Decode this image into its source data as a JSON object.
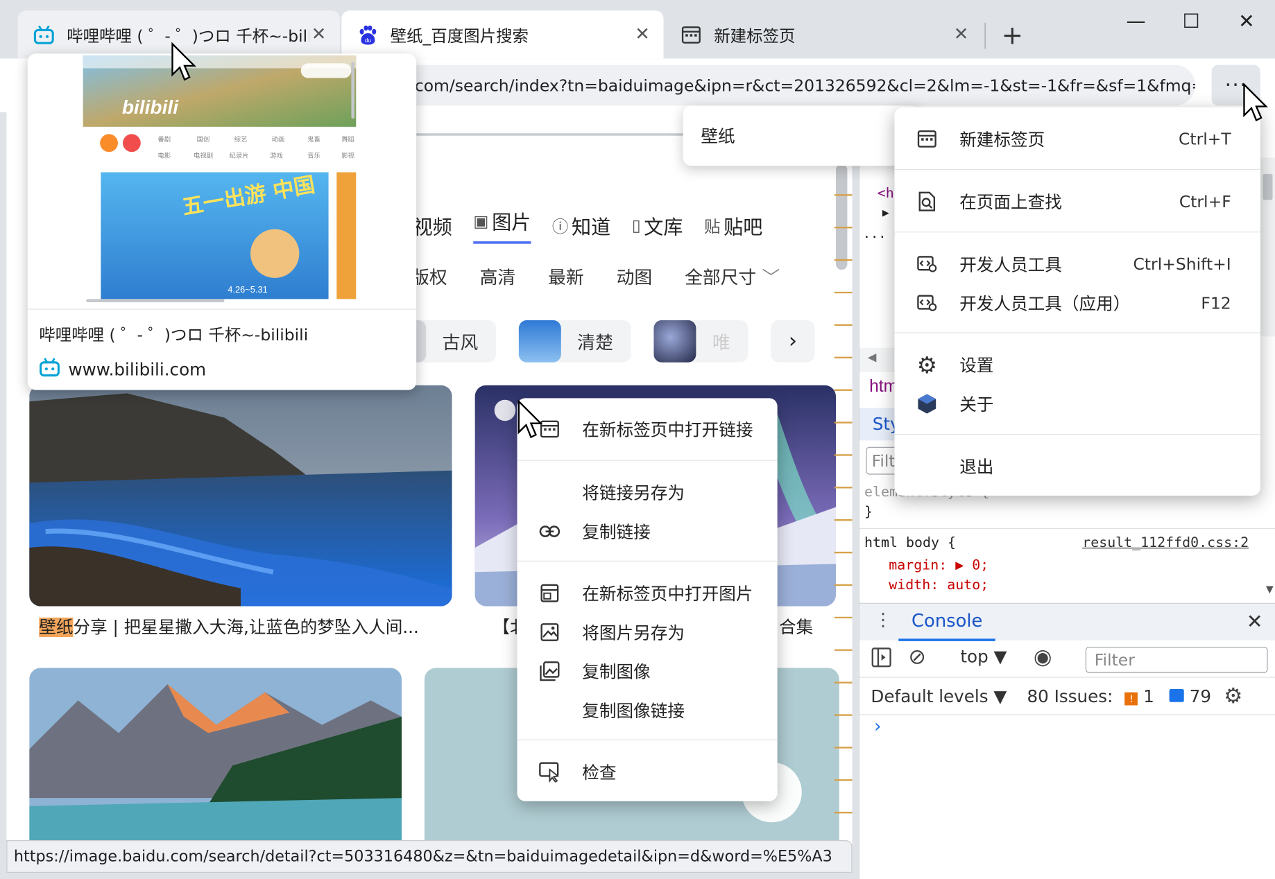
{
  "tabs": [
    {
      "label": "哔哩哔哩 ( ゜- ゜)つロ 千杯~-bilibili",
      "close": "✕"
    },
    {
      "label": "壁纸_百度图片搜索",
      "close": "✕"
    },
    {
      "label": "新建标签页",
      "close": "✕"
    }
  ],
  "new_tab": "+",
  "window_controls": {
    "minimize": "—",
    "maximize": "☐",
    "close": "✕"
  },
  "address_bar": {
    "url": "com/search/index?tn=baiduimage&ipn=r&ct=201326592&cl=2&lm=-1&st=-1&fr=&sf=1&fmq=1"
  },
  "more_button": "···",
  "hover_card": {
    "title": "哔哩哔哩 ( ゜- ゜)つロ 千杯~-bilibili",
    "url": "www.bilibili.com",
    "preview": {
      "brand": "bilibili",
      "banner_text": "五一出游 中国",
      "date_text": "4.26~5.31"
    }
  },
  "search_suggestion": {
    "text": "壁纸"
  },
  "page": {
    "nav_tabs": [
      {
        "label": "视频",
        "icon": "video-icon"
      },
      {
        "label": "图片",
        "icon": "image-icon",
        "active": true
      },
      {
        "label": "知道",
        "icon": "question-icon"
      },
      {
        "label": "文库",
        "icon": "doc-icon"
      },
      {
        "label": "贴吧",
        "icon": "tieba-icon"
      }
    ],
    "filters": [
      "版权",
      "高清",
      "最新",
      "动图",
      "全部尺寸"
    ],
    "tags": [
      {
        "label": "古风",
        "color": "#c9cdd3"
      },
      {
        "label": "清楚",
        "color": "#4a8fe0"
      },
      {
        "label": "唯",
        "color": "#3b3f6a"
      }
    ],
    "tags_next": "›",
    "captions": [
      {
        "highlight": "壁纸",
        "rest": "分享 | 把星星撒入大海,让蓝色的梦坠入人间..."
      },
      {
        "text": "【北",
        "suffix": "合集"
      }
    ]
  },
  "status_bar": {
    "url": "https://image.baidu.com/search/detail?ct=503316480&z=&tn=baiduimagedetail&ipn=d&word=%E5%A3"
  },
  "context_menu": {
    "items": [
      {
        "label": "在新标签页中打开链接",
        "icon": "new-tab-icon"
      },
      {
        "label": "将链接另存为",
        "icon": ""
      },
      {
        "label": "复制链接",
        "icon": "link-icon"
      },
      {
        "label": "在新标签页中打开图片",
        "icon": "open-image-icon"
      },
      {
        "label": "将图片另存为",
        "icon": "save-image-icon"
      },
      {
        "label": "复制图像",
        "icon": "copy-image-icon"
      },
      {
        "label": "复制图像链接",
        "icon": ""
      },
      {
        "label": "检查",
        "icon": "inspect-icon"
      }
    ]
  },
  "app_menu": {
    "items": [
      {
        "label": "新建标签页",
        "shortcut": "Ctrl+T",
        "icon": "new-tab-icon"
      },
      {
        "label": "在页面上查找",
        "shortcut": "Ctrl+F",
        "icon": "find-icon"
      },
      {
        "label": "开发人员工具",
        "shortcut": "Ctrl+Shift+I",
        "icon": "devtools-icon"
      },
      {
        "label": "开发人员工具（应用）",
        "shortcut": "F12",
        "icon": "devtools-icon"
      },
      {
        "label": "设置",
        "shortcut": "",
        "icon": "gear-icon"
      },
      {
        "label": "关于",
        "shortcut": "",
        "icon": "about-icon"
      },
      {
        "label": "退出",
        "shortcut": "",
        "icon": ""
      }
    ]
  },
  "devtools": {
    "html_label": "htm",
    "styles_label": "Sty",
    "filter_label": "Filt",
    "element_style": "element.style {",
    "element_style_close": "}",
    "rule_selector": "html body {",
    "rule_source": "result_112ffd0.css:2",
    "rule_lines": [
      "margin: ▶ 0;",
      "width: auto;"
    ],
    "console_tab": "Console",
    "context_select": "top",
    "filter_placeholder": "Filter",
    "levels": "Default levels",
    "issues_label": "80 Issues:",
    "issues_warn": "1",
    "issues_info": "79",
    "prompt": "›"
  },
  "colors": {
    "accent": "#1a73e8",
    "baidu_blue": "#4e6ef2",
    "highlight": "#f3a55a",
    "bilibili": "#00a1d6"
  }
}
